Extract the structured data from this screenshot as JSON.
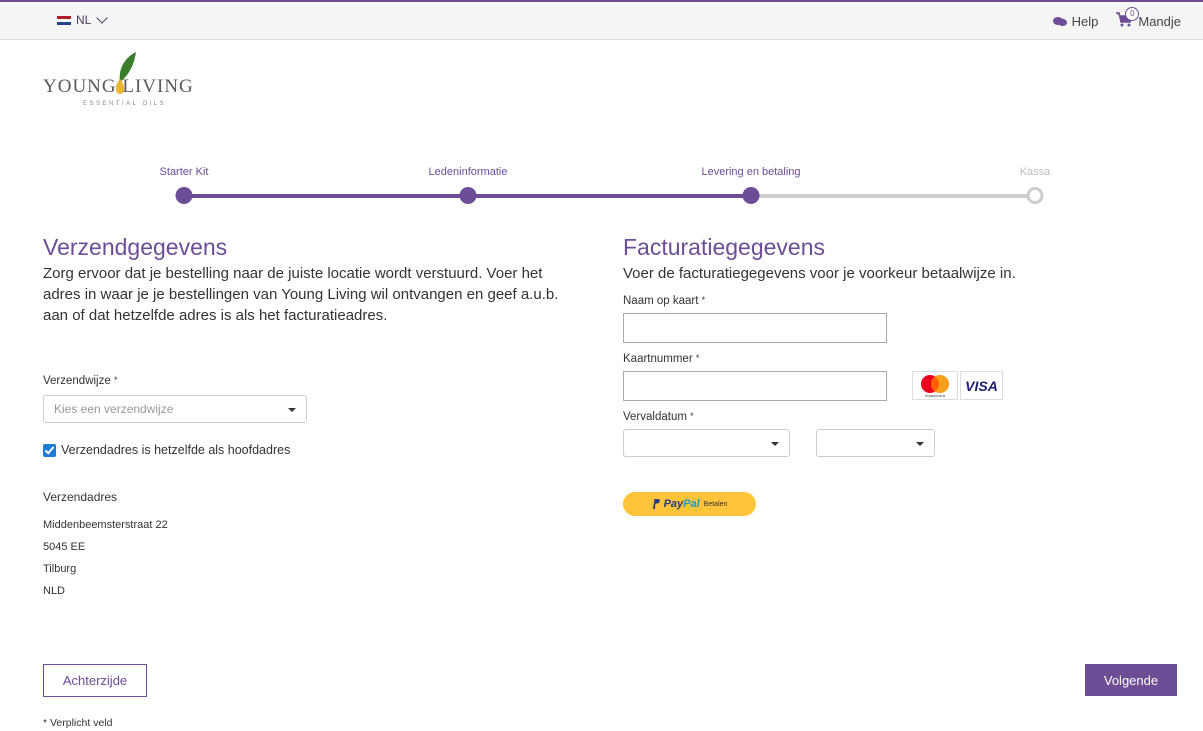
{
  "topbar": {
    "language": "NL",
    "help_label": "Help",
    "cart_count": "0",
    "cart_label": "Mandje"
  },
  "logo": {
    "brand": "YOUNG LIVING",
    "sub": "ESSENTIAL OILS"
  },
  "steps": [
    {
      "label": "Starter Kit",
      "state": "done"
    },
    {
      "label": "Ledeninformatie",
      "state": "done"
    },
    {
      "label": "Levering en betaling",
      "state": "current"
    },
    {
      "label": "Kassa",
      "state": "todo"
    }
  ],
  "shipping": {
    "title": "Verzendgegevens",
    "intro": "Zorg ervoor dat je bestelling naar de juiste locatie wordt verstuurd. Voer het adres in waar je je bestellingen van Young Living wil ontvangen en geef a.u.b. aan of dat hetzelfde adres is als het facturatieadres.",
    "method_label": "Verzendwijze",
    "method_placeholder": "Kies een verzendwijze",
    "same_address_label": "Verzendadres is hetzelfde als hoofdadres",
    "same_address_checked": true,
    "address_heading": "Verzendadres",
    "address_lines": [
      "Middenbeemsterstraat 22",
      "5045 EE",
      "Tilburg",
      "NLD"
    ]
  },
  "billing": {
    "title": "Facturatiegegevens",
    "intro": "Voer de facturatiegegevens voor je voorkeur betaalwijze in.",
    "name_label": "Naam op kaart",
    "card_label": "Kaartnummer",
    "expiry_label": "Vervaldatum",
    "card_brands": [
      "mastercard",
      "VISA"
    ],
    "paypal_label": "PayPal",
    "paypal_action": "Betalen"
  },
  "required_mark": "*",
  "buttons": {
    "back": "Achterzijde",
    "next": "Volgende"
  },
  "footnote": "* Verplicht veld",
  "colors": {
    "accent": "#6d4d96",
    "inactive": "#cccccc",
    "paypal": "#ffc439",
    "checkbox": "#1e7bd8"
  }
}
